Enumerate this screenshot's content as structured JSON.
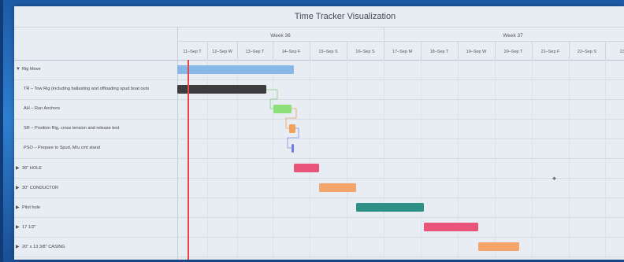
{
  "title": "Time Tracker Visualization",
  "weeks": [
    "Week 36",
    "Week 37"
  ],
  "days": [
    "11–Sep T",
    "12–Sep W",
    "13–Sep T",
    "14–Sep F",
    "15–Sep S",
    "16–Sep S",
    "17–Sep M",
    "18–Sep T",
    "19–Sep W",
    "20–Sep T",
    "21–Sep F",
    "22–Sep S",
    "23–"
  ],
  "tasks": [
    {
      "label": "Rig Move",
      "expand": "▼",
      "color": "#87b8e8"
    },
    {
      "label": "TR – Tow Rig (including ballasting and offloading spud boat outs",
      "expand": "",
      "color": "#3d3d3f"
    },
    {
      "label": "AH – Run Anchors",
      "expand": "",
      "color": "#8be07a"
    },
    {
      "label": "SR – Position Rig, cross tension and release test",
      "expand": "",
      "color": "#f3a05b"
    },
    {
      "label": "PSO – Prepare to Spud, M/u cmt stand",
      "expand": "",
      "color": "#6f7fe0"
    },
    {
      "label": "36\" HOLE",
      "expand": "▶",
      "color": "#e9557a"
    },
    {
      "label": "30\" CONDUCTOR",
      "expand": "▶",
      "color": "#f3a56b"
    },
    {
      "label": "Pilot hole",
      "expand": "▶",
      "color": "#2e8f86"
    },
    {
      "label": "17 1/2\"",
      "expand": "▶",
      "color": "#e9557a"
    },
    {
      "label": "20\" x 13 3/8\" CASING",
      "expand": "▶",
      "color": "#f3a56b"
    }
  ],
  "colors": {
    "today_marker": "#e8434b",
    "background": "#e8edf4"
  }
}
